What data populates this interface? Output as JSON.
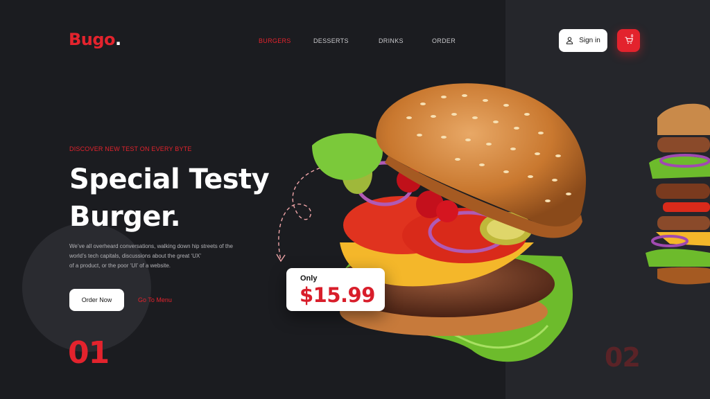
{
  "brand": {
    "name": "Bugo",
    "dot": "."
  },
  "nav": [
    {
      "label": "BURGERS",
      "active": true
    },
    {
      "label": "DESSERTS",
      "active": false
    },
    {
      "label": "DRINKS",
      "active": false
    },
    {
      "label": "ORDER",
      "active": false
    }
  ],
  "header": {
    "signin_label": "Sign in",
    "cart_count": "0",
    "signin_icon": "user-icon",
    "cart_icon": "cart-icon"
  },
  "hero": {
    "tagline": "DISCOVER NEW TEST ON EVERY BYTE",
    "headline_line1": "Special Testy",
    "headline_line2": "Burger.",
    "description_lines": [
      "We’ve all overheard conversations, walking down hip streets of the",
      "world’s tech capitals, discussions about the great ‘UX’",
      "of a product, or the poor ‘UI’ of a website."
    ],
    "order_button": "Order Now",
    "menu_link": "Go To Menu"
  },
  "price": {
    "label": "Only",
    "value": "$15.99"
  },
  "slides": {
    "current": "01",
    "next": "02"
  },
  "colors": {
    "accent": "#e3232d",
    "background": "#1b1c20",
    "panel": "#25262b"
  }
}
